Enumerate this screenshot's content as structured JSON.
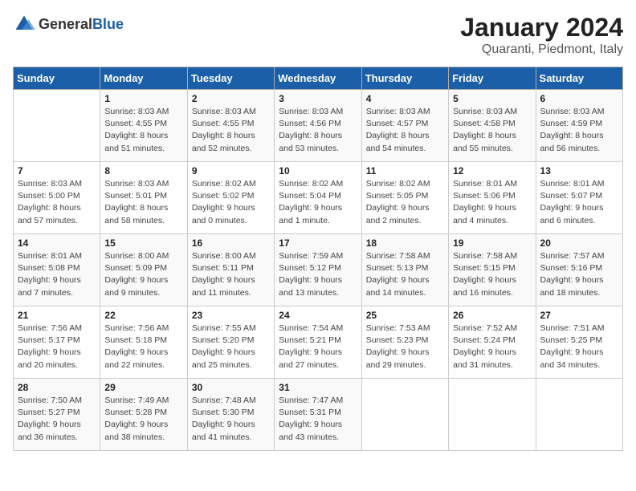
{
  "logo": {
    "general": "General",
    "blue": "Blue"
  },
  "title": "January 2024",
  "subtitle": "Quaranti, Piedmont, Italy",
  "days_of_week": [
    "Sunday",
    "Monday",
    "Tuesday",
    "Wednesday",
    "Thursday",
    "Friday",
    "Saturday"
  ],
  "weeks": [
    [
      {
        "day": null
      },
      {
        "day": "1",
        "sunrise": "8:03 AM",
        "sunset": "4:55 PM",
        "daylight": "8 hours and 51 minutes."
      },
      {
        "day": "2",
        "sunrise": "8:03 AM",
        "sunset": "4:55 PM",
        "daylight": "8 hours and 52 minutes."
      },
      {
        "day": "3",
        "sunrise": "8:03 AM",
        "sunset": "4:56 PM",
        "daylight": "8 hours and 53 minutes."
      },
      {
        "day": "4",
        "sunrise": "8:03 AM",
        "sunset": "4:57 PM",
        "daylight": "8 hours and 54 minutes."
      },
      {
        "day": "5",
        "sunrise": "8:03 AM",
        "sunset": "4:58 PM",
        "daylight": "8 hours and 55 minutes."
      },
      {
        "day": "6",
        "sunrise": "8:03 AM",
        "sunset": "4:59 PM",
        "daylight": "8 hours and 56 minutes."
      }
    ],
    [
      {
        "day": "7",
        "sunrise": "8:03 AM",
        "sunset": "5:00 PM",
        "daylight": "8 hours and 57 minutes."
      },
      {
        "day": "8",
        "sunrise": "8:03 AM",
        "sunset": "5:01 PM",
        "daylight": "8 hours and 58 minutes."
      },
      {
        "day": "9",
        "sunrise": "8:02 AM",
        "sunset": "5:02 PM",
        "daylight": "9 hours and 0 minutes."
      },
      {
        "day": "10",
        "sunrise": "8:02 AM",
        "sunset": "5:04 PM",
        "daylight": "9 hours and 1 minute."
      },
      {
        "day": "11",
        "sunrise": "8:02 AM",
        "sunset": "5:05 PM",
        "daylight": "9 hours and 2 minutes."
      },
      {
        "day": "12",
        "sunrise": "8:01 AM",
        "sunset": "5:06 PM",
        "daylight": "9 hours and 4 minutes."
      },
      {
        "day": "13",
        "sunrise": "8:01 AM",
        "sunset": "5:07 PM",
        "daylight": "9 hours and 6 minutes."
      }
    ],
    [
      {
        "day": "14",
        "sunrise": "8:01 AM",
        "sunset": "5:08 PM",
        "daylight": "9 hours and 7 minutes."
      },
      {
        "day": "15",
        "sunrise": "8:00 AM",
        "sunset": "5:09 PM",
        "daylight": "9 hours and 9 minutes."
      },
      {
        "day": "16",
        "sunrise": "8:00 AM",
        "sunset": "5:11 PM",
        "daylight": "9 hours and 11 minutes."
      },
      {
        "day": "17",
        "sunrise": "7:59 AM",
        "sunset": "5:12 PM",
        "daylight": "9 hours and 13 minutes."
      },
      {
        "day": "18",
        "sunrise": "7:58 AM",
        "sunset": "5:13 PM",
        "daylight": "9 hours and 14 minutes."
      },
      {
        "day": "19",
        "sunrise": "7:58 AM",
        "sunset": "5:15 PM",
        "daylight": "9 hours and 16 minutes."
      },
      {
        "day": "20",
        "sunrise": "7:57 AM",
        "sunset": "5:16 PM",
        "daylight": "9 hours and 18 minutes."
      }
    ],
    [
      {
        "day": "21",
        "sunrise": "7:56 AM",
        "sunset": "5:17 PM",
        "daylight": "9 hours and 20 minutes."
      },
      {
        "day": "22",
        "sunrise": "7:56 AM",
        "sunset": "5:18 PM",
        "daylight": "9 hours and 22 minutes."
      },
      {
        "day": "23",
        "sunrise": "7:55 AM",
        "sunset": "5:20 PM",
        "daylight": "9 hours and 25 minutes."
      },
      {
        "day": "24",
        "sunrise": "7:54 AM",
        "sunset": "5:21 PM",
        "daylight": "9 hours and 27 minutes."
      },
      {
        "day": "25",
        "sunrise": "7:53 AM",
        "sunset": "5:23 PM",
        "daylight": "9 hours and 29 minutes."
      },
      {
        "day": "26",
        "sunrise": "7:52 AM",
        "sunset": "5:24 PM",
        "daylight": "9 hours and 31 minutes."
      },
      {
        "day": "27",
        "sunrise": "7:51 AM",
        "sunset": "5:25 PM",
        "daylight": "9 hours and 34 minutes."
      }
    ],
    [
      {
        "day": "28",
        "sunrise": "7:50 AM",
        "sunset": "5:27 PM",
        "daylight": "9 hours and 36 minutes."
      },
      {
        "day": "29",
        "sunrise": "7:49 AM",
        "sunset": "5:28 PM",
        "daylight": "9 hours and 38 minutes."
      },
      {
        "day": "30",
        "sunrise": "7:48 AM",
        "sunset": "5:30 PM",
        "daylight": "9 hours and 41 minutes."
      },
      {
        "day": "31",
        "sunrise": "7:47 AM",
        "sunset": "5:31 PM",
        "daylight": "9 hours and 43 minutes."
      },
      {
        "day": null
      },
      {
        "day": null
      },
      {
        "day": null
      }
    ]
  ]
}
